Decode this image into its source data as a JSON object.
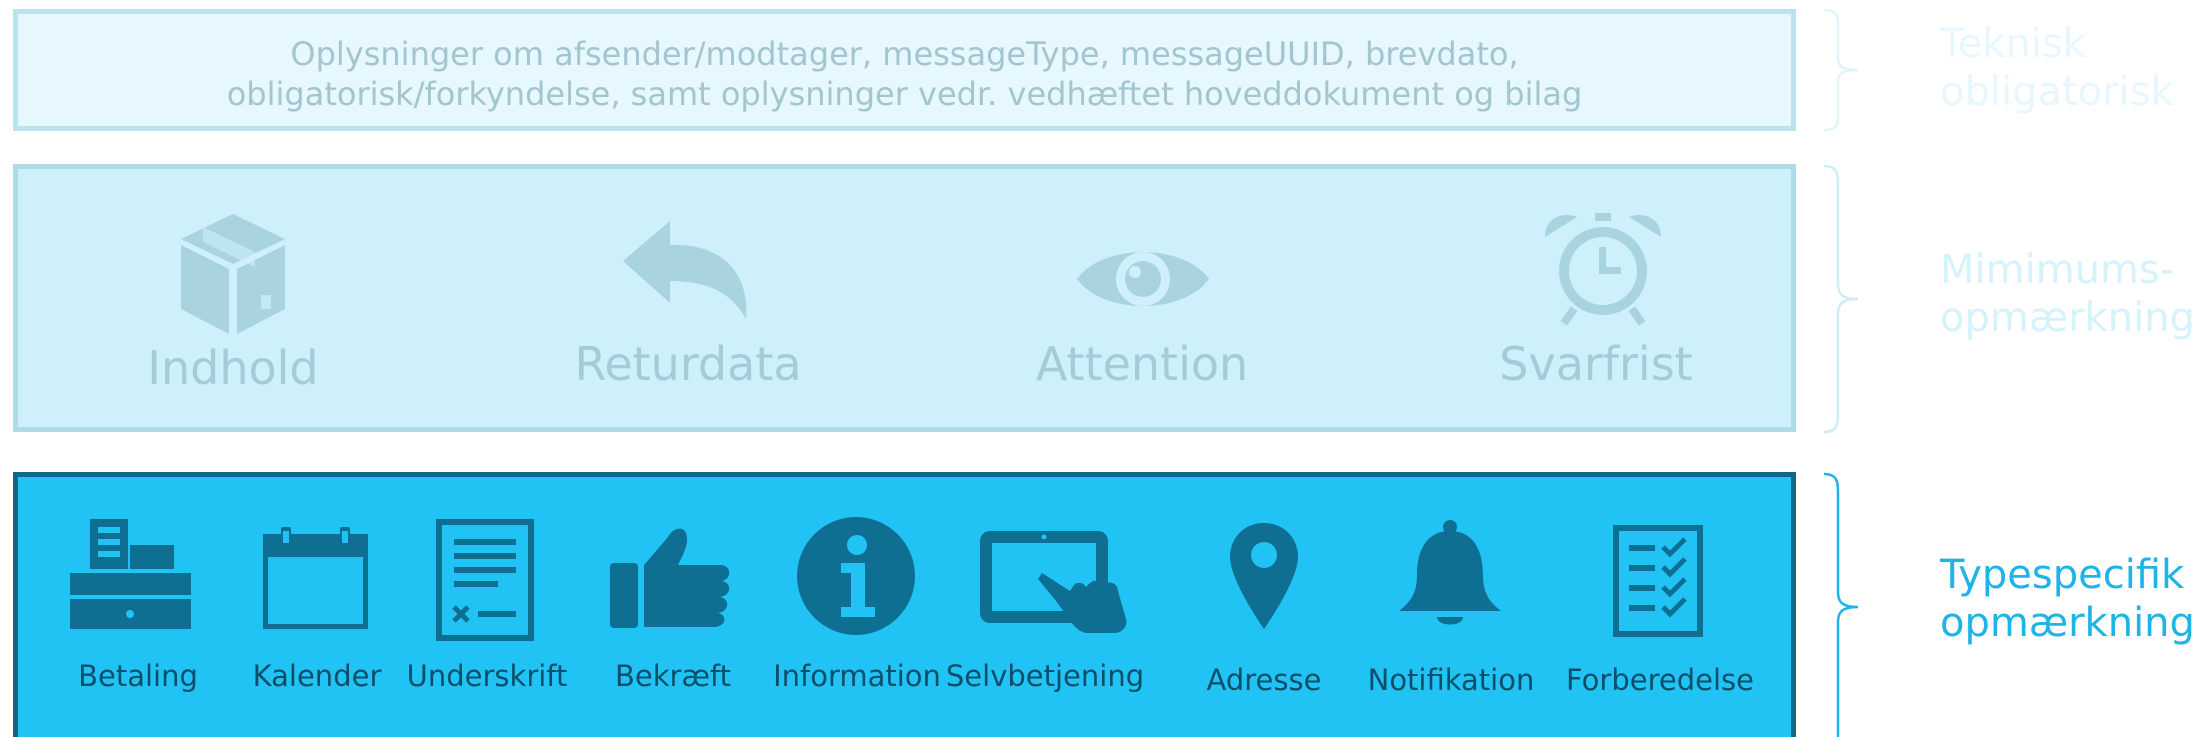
{
  "layers": {
    "technical": {
      "line1": "Oplysninger om afsender/modtager, messageType, messageUUID, brevdato,",
      "line2": "obligatorisk/forkyndelse, samt oplysninger vedr. vedhæftet hoveddokument og bilag",
      "side_label_line1": "Teknisk",
      "side_label_line2": "obligatorisk"
    },
    "minimum": {
      "items": [
        {
          "label": "Indhold",
          "icon": "package-icon"
        },
        {
          "label": "Returdata",
          "icon": "reply-arrow-icon"
        },
        {
          "label": "Attention",
          "icon": "eye-icon"
        },
        {
          "label": "Svarfrist",
          "icon": "alarm-clock-icon"
        }
      ],
      "side_label_line1": "Mimimums-",
      "side_label_line2": "opmærkning"
    },
    "typespecific": {
      "items": [
        {
          "label": "Betaling",
          "icon": "cash-register-icon"
        },
        {
          "label": "Kalender",
          "icon": "calendar-icon"
        },
        {
          "label": "Underskrift",
          "icon": "signature-document-icon"
        },
        {
          "label": "Bekræft",
          "icon": "thumbs-up-icon"
        },
        {
          "label": "Information",
          "icon": "info-icon"
        },
        {
          "label": "Selvbetjening",
          "icon": "tablet-touch-icon"
        },
        {
          "label": "Adresse",
          "icon": "map-pin-icon"
        },
        {
          "label": "Notifikation",
          "icon": "bell-icon"
        },
        {
          "label": "Forberedelse",
          "icon": "checklist-icon"
        }
      ],
      "side_label_line1": "Typespecifik",
      "side_label_line2": "opmærkning"
    }
  },
  "colors": {
    "layer1_bg": "#e6f7fd",
    "layer2_bg": "#cdf0fb",
    "layer3_bg": "#21c3f4",
    "layer3_border": "#0b6a8a",
    "icon_dark": "#0e6f92",
    "icon_light": "#a9d3df",
    "accent_label": "#1eb4e6"
  }
}
